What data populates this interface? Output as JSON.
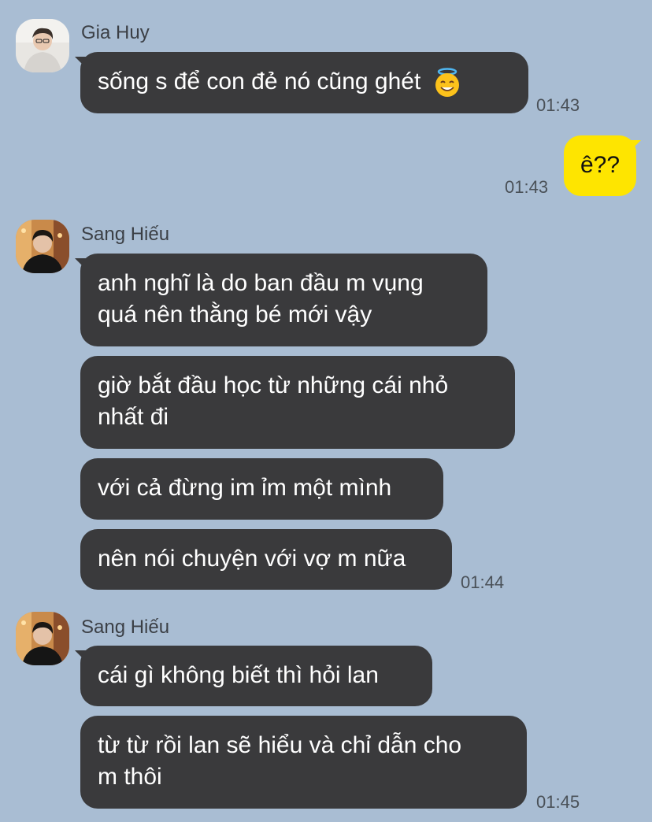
{
  "messages": {
    "m1": {
      "sender": "Gia Huy",
      "text": "sống s để con đẻ nó cũng ghét",
      "emoji": "smiling-face-with-halo",
      "time": "01:43"
    },
    "m2": {
      "text": "ê??",
      "time": "01:43"
    },
    "g3": {
      "sender": "Sang Hiếu",
      "b1_line1": "anh nghĩ là do ban đầu m vụng",
      "b1_line2": "quá nên thằng bé mới vậy",
      "b2_line1": "giờ bắt đầu học từ những cái nhỏ",
      "b2_line2": "nhất đi",
      "b3": "với cả đừng im ỉm một mình",
      "b4": "nên nói chuyện với vợ m nữa",
      "time": "01:44"
    },
    "g4": {
      "sender": "Sang Hiếu",
      "b1": "cái gì không biết thì hỏi lan",
      "b2_line1": "từ từ rồi lan sẽ hiểu và chỉ dẫn cho",
      "b2_line2": "m thôi",
      "time": "01:45"
    }
  },
  "colors": {
    "background": "#a9bdd3",
    "incoming_bubble": "#3a3a3c",
    "outgoing_bubble": "#fee500"
  }
}
